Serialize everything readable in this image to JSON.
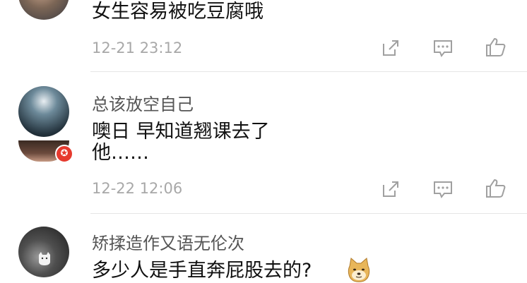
{
  "comments": [
    {
      "username": "",
      "text": "女生容易被吃豆腐哦",
      "time": "12-21 23:12"
    },
    {
      "username": "总该放空自己",
      "text_line1": "噢日 早知道翘课去了",
      "text_line2": "他……",
      "time": "12-22 12:06",
      "badge_icon": "star-badge-icon"
    },
    {
      "username": "矫揉造作又语无伦次",
      "text": "多少人是手直奔屁股去的?",
      "emoji": "doge-emoji-icon"
    }
  ],
  "actions": [
    "share-icon",
    "comment-icon",
    "like-icon"
  ],
  "colors": {
    "timestamp": "#a8a8a8",
    "username": "#555555",
    "badge": "#e63a2e",
    "divider": "#e6e6e6"
  }
}
